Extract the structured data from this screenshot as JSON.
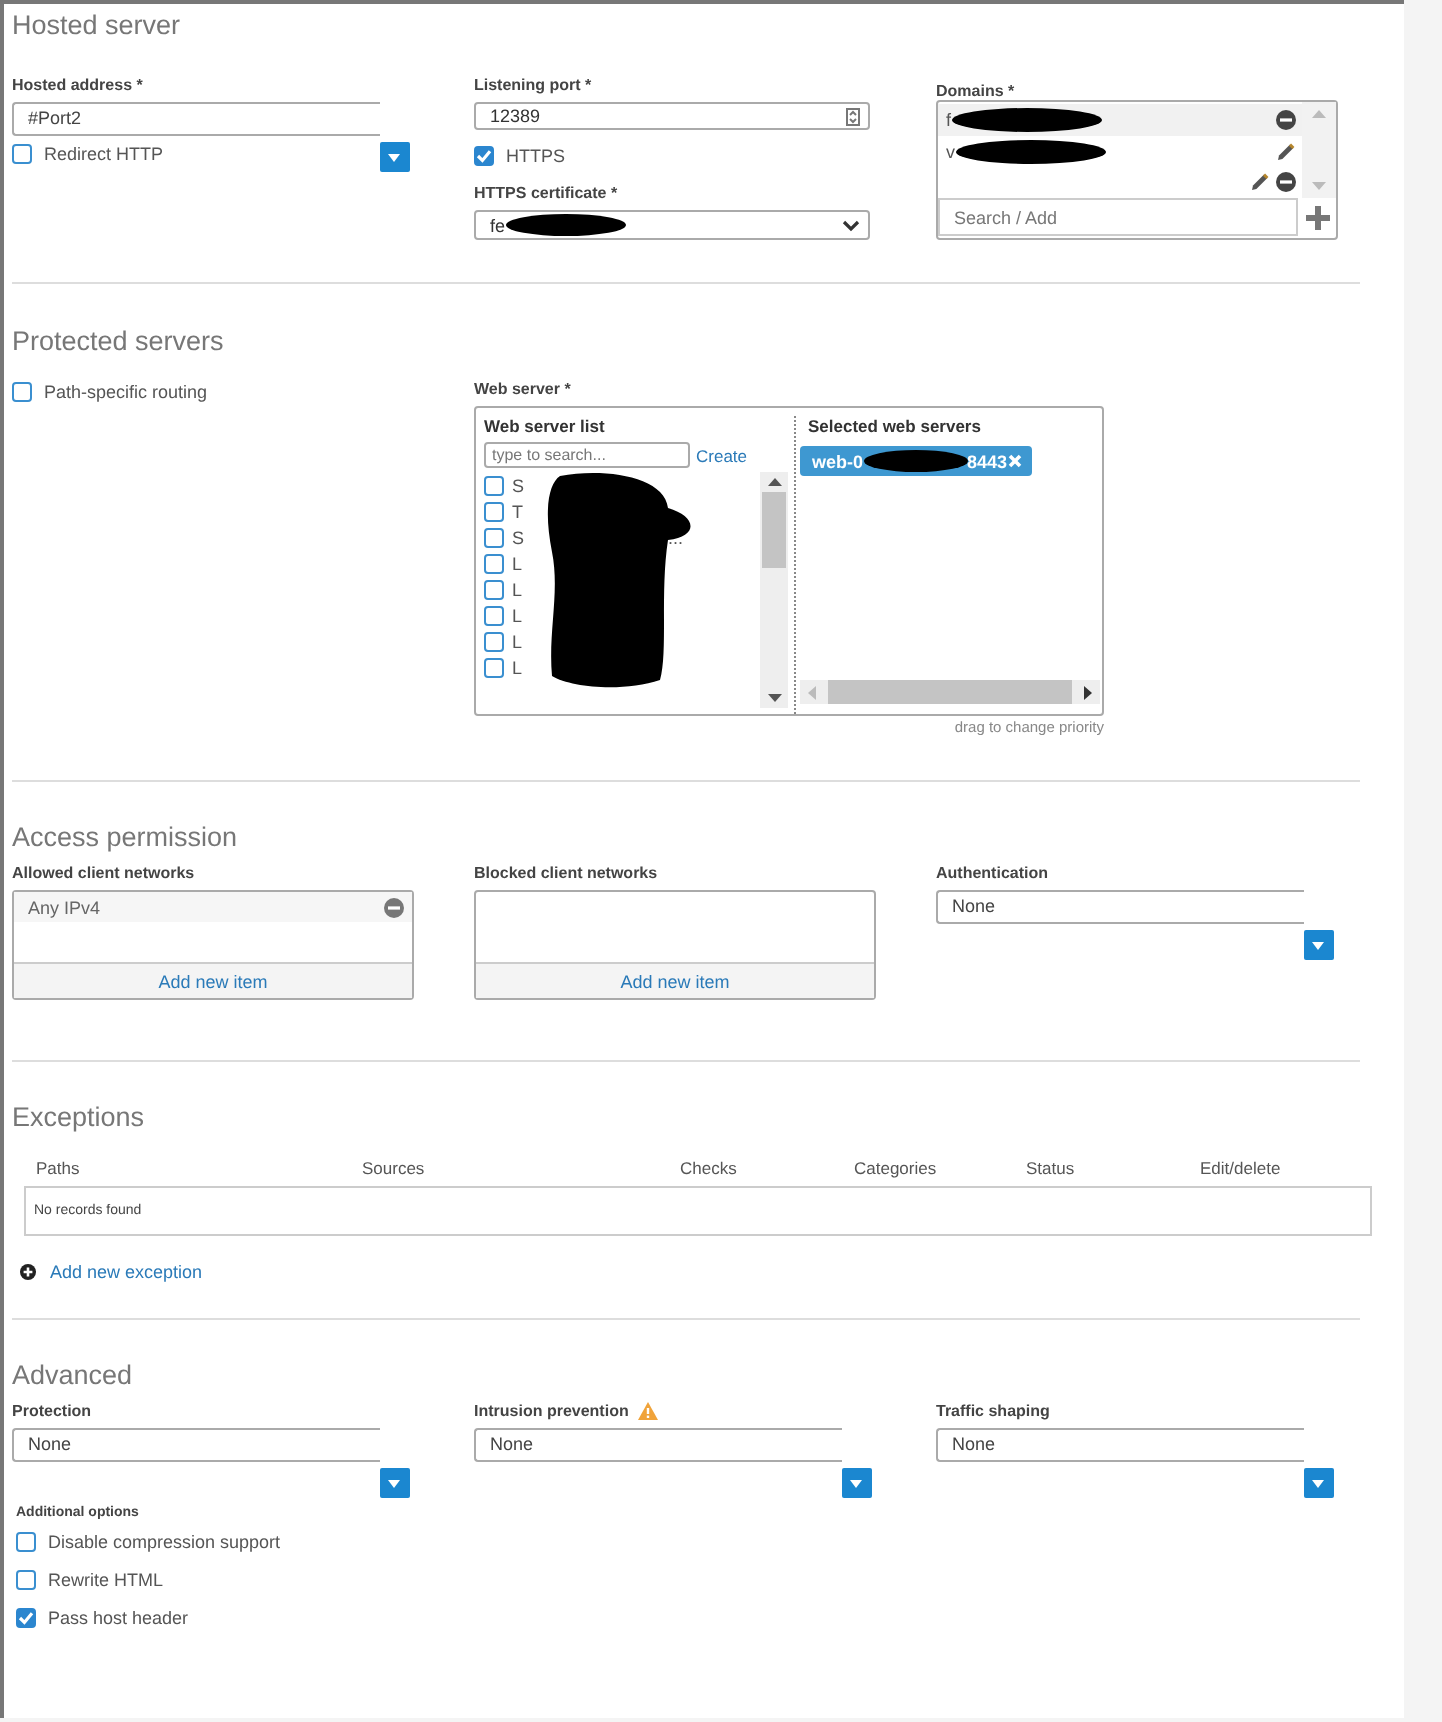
{
  "hosted_server": {
    "title": "Hosted server",
    "hosted_address": {
      "label": "Hosted address *",
      "value": "#Port2"
    },
    "redirect_http": {
      "label": "Redirect HTTP",
      "checked": false
    },
    "listening_port": {
      "label": "Listening port *",
      "value": "12389"
    },
    "https": {
      "label": "HTTPS",
      "checked": true
    },
    "https_certificate": {
      "label": "HTTPS certificate *",
      "value": "fe"
    },
    "domains": {
      "label": "Domains *",
      "placeholder": "Search / Add",
      "items": [
        {
          "text": "f",
          "selected": true,
          "editable": false,
          "removable": true
        },
        {
          "text": "v",
          "selected": false,
          "editable": true,
          "removable": false
        },
        {
          "selected": false,
          "editable": true,
          "removable": true
        }
      ]
    }
  },
  "protected_servers": {
    "title": "Protected servers",
    "path_routing": {
      "label": "Path-specific routing",
      "checked": false
    },
    "web_server": {
      "label": "Web server *",
      "list_title": "Web server list",
      "search_placeholder": "type to search...",
      "create": "Create",
      "items": [
        {
          "text": "S",
          "checked": false
        },
        {
          "text": "T",
          "checked": false
        },
        {
          "text": "S",
          "tail": "...",
          "checked": false
        },
        {
          "text": "L",
          "checked": false
        },
        {
          "text": "L",
          "checked": false
        },
        {
          "text": "L",
          "checked": false
        },
        {
          "text": "L",
          "checked": false
        },
        {
          "text": "L",
          "checked": false
        }
      ],
      "selected_title": "Selected web servers",
      "selected": [
        {
          "start": "web-0",
          "end": "8443"
        }
      ],
      "hint": "drag to change priority"
    }
  },
  "access_permission": {
    "title": "Access permission",
    "allowed": {
      "label": "Allowed client networks",
      "items": [
        "Any IPv4"
      ],
      "add": "Add new item"
    },
    "blocked": {
      "label": "Blocked client networks",
      "add": "Add new item"
    },
    "authentication": {
      "label": "Authentication",
      "value": "None"
    }
  },
  "exceptions": {
    "title": "Exceptions",
    "columns": [
      "Paths",
      "Sources",
      "Checks",
      "Categories",
      "Status",
      "Edit/delete"
    ],
    "empty": "No records found",
    "add": "Add new exception"
  },
  "advanced": {
    "title": "Advanced",
    "protection": {
      "label": "Protection",
      "value": "None"
    },
    "intrusion_prevention": {
      "label": "Intrusion prevention",
      "value": "None",
      "warning": true
    },
    "traffic_shaping": {
      "label": "Traffic shaping",
      "value": "None"
    },
    "additional_label": "Additional options",
    "options": [
      {
        "label": "Disable compression support",
        "checked": false
      },
      {
        "label": "Rewrite HTML",
        "checked": false
      },
      {
        "label": "Pass host header",
        "checked": true
      }
    ]
  }
}
